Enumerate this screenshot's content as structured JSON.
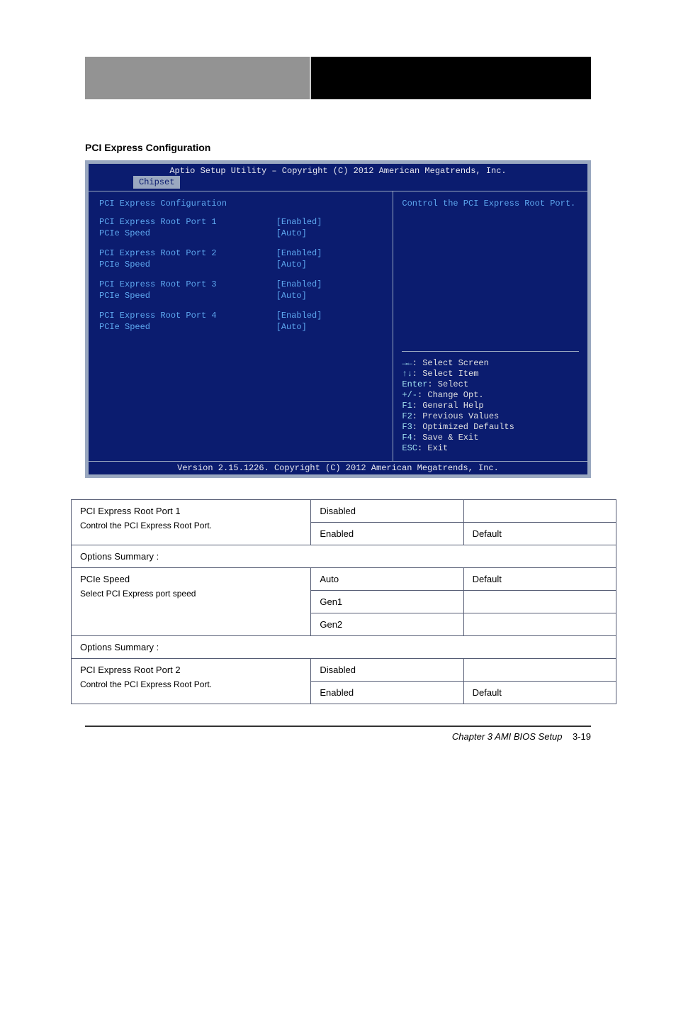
{
  "header": {
    "right_text": ""
  },
  "section_title": "PCI Express Configuration",
  "bios": {
    "top": "Aptio Setup Utility – Copyright (C) 2012 American Megatrends, Inc.",
    "tab": "Chipset",
    "heading": "PCI Express Configuration",
    "rows": [
      {
        "label": "PCI Express Root Port 1",
        "value": "[Enabled]"
      },
      {
        "label": "PCIe Speed",
        "value": "[Auto]"
      },
      {
        "spacer": true
      },
      {
        "label": "PCI Express Root Port 2",
        "value": "[Enabled]"
      },
      {
        "label": "PCIe Speed",
        "value": "[Auto]"
      },
      {
        "spacer": true
      },
      {
        "label": "PCI Express Root Port 3",
        "value": "[Enabled]"
      },
      {
        "label": "PCIe Speed",
        "value": "[Auto]"
      },
      {
        "spacer": true
      },
      {
        "label": "PCI Express Root Port 4",
        "value": "[Enabled]"
      },
      {
        "label": "PCIe Speed",
        "value": "[Auto]"
      }
    ],
    "help_top": "Control the PCI Express Root Port.",
    "help_keys": [
      {
        "key": "→←",
        "txt": ": Select Screen"
      },
      {
        "key": "↑↓",
        "txt": ": Select Item"
      },
      {
        "key": "Enter",
        "txt": ": Select"
      },
      {
        "key": "+/-",
        "txt": ": Change Opt."
      },
      {
        "key": "F1",
        "txt": ": General Help"
      },
      {
        "key": "F2",
        "txt": ": Previous Values"
      },
      {
        "key": "F3",
        "txt": ": Optimized Defaults"
      },
      {
        "key": "F4",
        "txt": ": Save & Exit"
      },
      {
        "key": "ESC",
        "txt": ": Exit"
      }
    ],
    "footer": "Version 2.15.1226. Copyright (C) 2012 American Megatrends, Inc."
  },
  "table": {
    "r0": {
      "c0": "PCI Express Root Port 1",
      "c01": "Control the PCI Express Root Port.",
      "c1a": "Disabled",
      "c2a": "",
      "c1b": "Enabled",
      "c2b": "Default"
    },
    "r1full": "Options Summary :",
    "r2": {
      "c0": "PCIe Speed",
      "c01": "Select PCI Express port speed",
      "c1a": "Auto",
      "c2a": "Default",
      "c1b": "Gen1",
      "c2b": "",
      "c1c": "Gen2",
      "c2c": ""
    },
    "r3full": "Options Summary :",
    "r4": {
      "c0": "PCI Express Root Port 2",
      "c01": "Control the PCI Express Root Port.",
      "c1a": "Disabled",
      "c2a": "",
      "c1b": "Enabled",
      "c2b": "Default"
    }
  },
  "footer": {
    "right": "Chapter 3 AMI BIOS Setup",
    "page": "3-19"
  }
}
